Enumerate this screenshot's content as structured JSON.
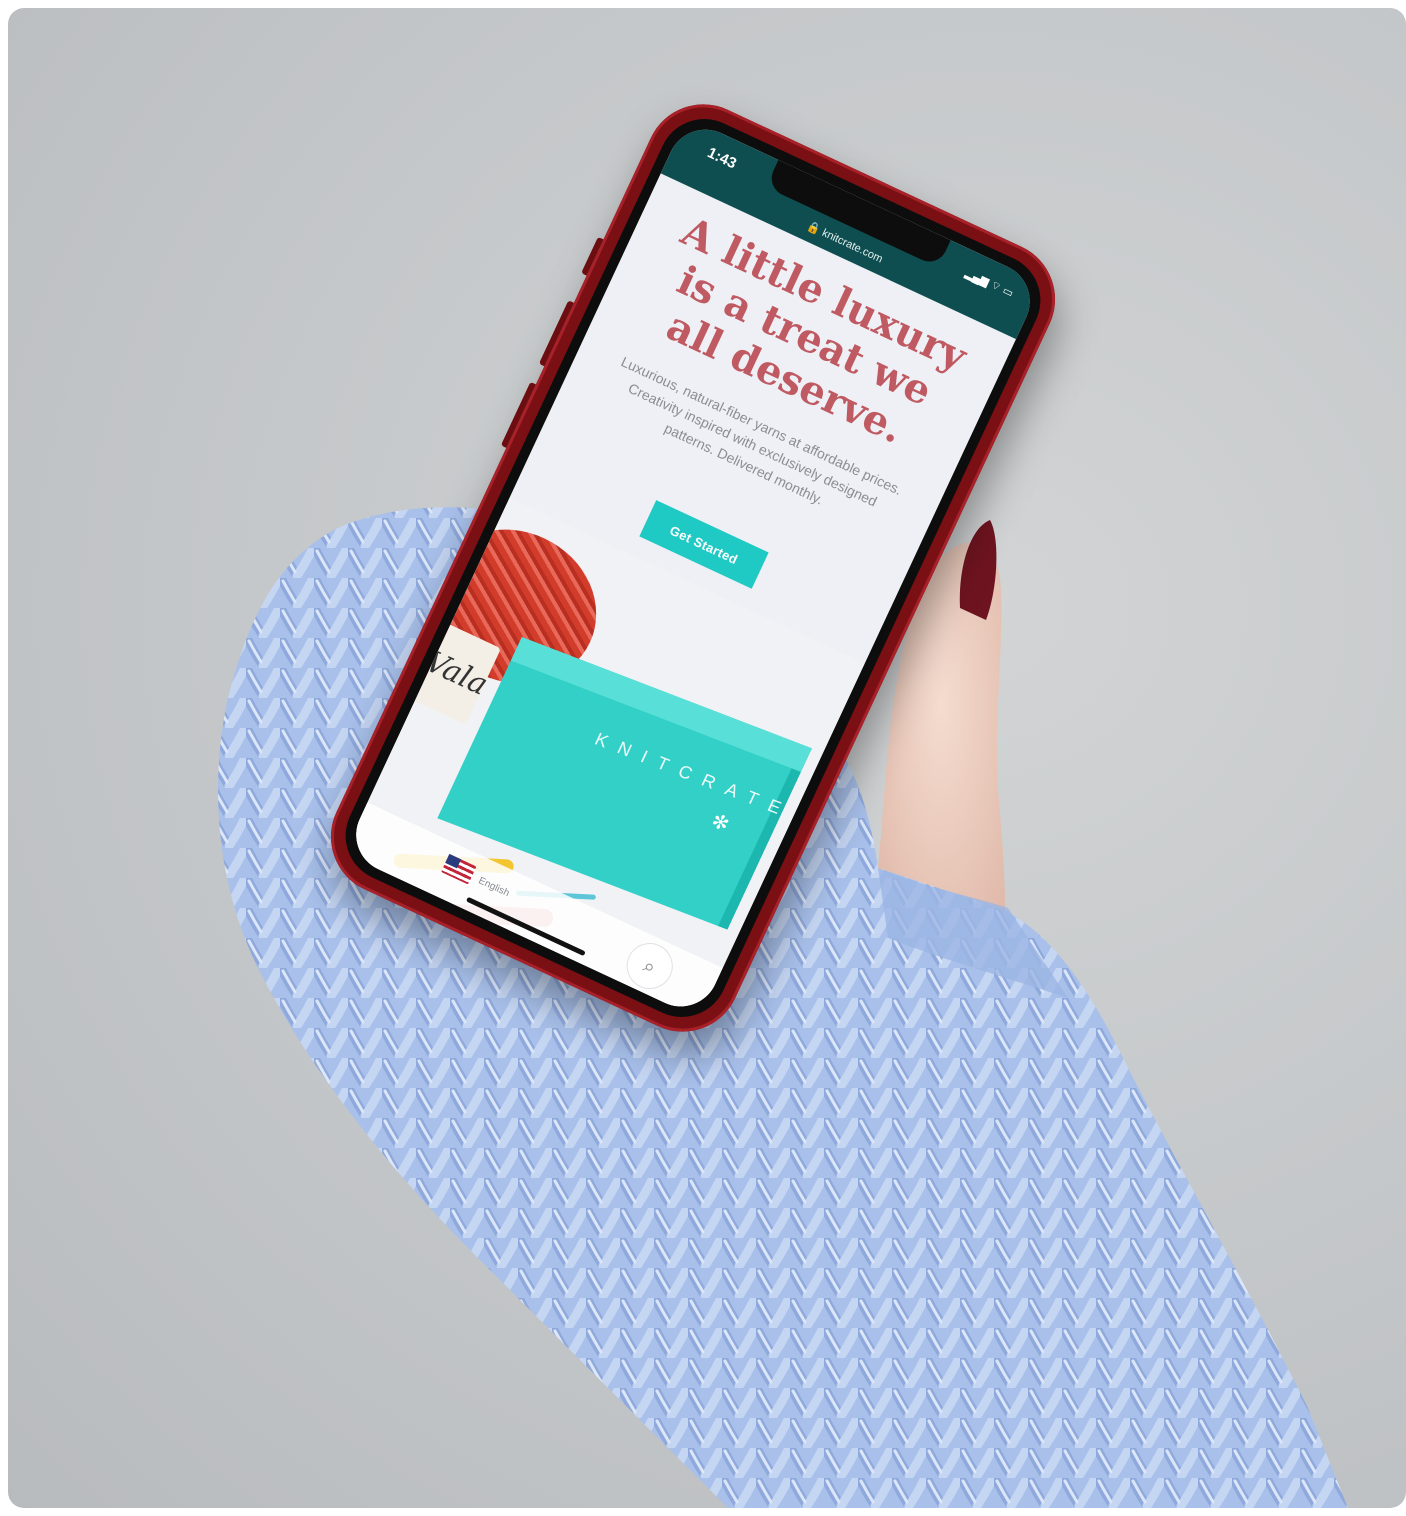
{
  "scene": {
    "description_colors": {
      "background": "#c4c7c9",
      "mitten": "#a9c2ec",
      "phone_case": "#7a1014",
      "nail_polish": "#6e1420",
      "skin": "#efd3c8"
    }
  },
  "phone": {
    "status_time": "1:43",
    "status_url": "🔒 knitcrate.com",
    "status_icons": "▂▄▆ ⌔ ▭",
    "headline": "A little luxury is a treat we all deserve.",
    "subcopy": "Luxurious, natural-fiber yarns at affordable prices. Creativity inspired with exclusively designed patterns. Delivered monthly.",
    "cta_label": "Get Started",
    "box_logo": "KNITCRATE",
    "box_star_icon": "✻",
    "tag_text": "Vala",
    "footer_text": "English",
    "chat_icon": "⌕",
    "colors": {
      "headline": "#c05a62",
      "cta": "#1fc9c4",
      "status_bar": "#0f4e50",
      "box": "#33d0c8"
    }
  }
}
